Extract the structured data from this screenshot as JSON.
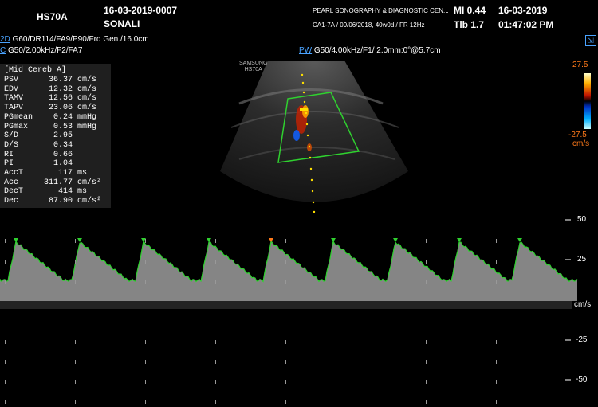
{
  "header": {
    "model": "HS70A",
    "patient_id": "16-03-2019-0007",
    "patient_name": "SONALI",
    "hospital": "PEARL SONOGRAPHY & DIAGNOSTIC CEN...",
    "exam_info": "CA1-7A / 09/06/2018, 40w0d / FR 12Hz",
    "mi": "MI  0.44",
    "tib": "Tlb 1.7",
    "date": "16-03-2019",
    "time": "01:47:02 PM"
  },
  "params": {
    "mode_2d_label": "2D",
    "mode_2d": "G60/DR114/FA9/P90/Frq Gen./16.0cm",
    "mode_c_label": "C",
    "mode_c": "G50/2.00kHz/F2/FA7",
    "mode_pw_label": "PW",
    "mode_pw": "G50/4.00kHz/F1/ 2.0mm:0°@5.7cm"
  },
  "logo": {
    "line1": "SAMSUNG",
    "line2": "HS70A"
  },
  "measurements": {
    "title": "[Mid Cereb A]",
    "rows": [
      {
        "label": "PSV",
        "value": "36.37",
        "unit": "cm/s"
      },
      {
        "label": "EDV",
        "value": "12.32",
        "unit": "cm/s"
      },
      {
        "label": "TAMV",
        "value": "12.56",
        "unit": "cm/s"
      },
      {
        "label": "TAPV",
        "value": "23.06",
        "unit": "cm/s"
      },
      {
        "label": "PGmean",
        "value": "0.24",
        "unit": "mmHg"
      },
      {
        "label": "PGmax",
        "value": "0.53",
        "unit": "mmHg"
      },
      {
        "label": "S/D",
        "value": "2.95",
        "unit": ""
      },
      {
        "label": "D/S",
        "value": "0.34",
        "unit": ""
      },
      {
        "label": "RI",
        "value": "0.66",
        "unit": ""
      },
      {
        "label": "PI",
        "value": "1.04",
        "unit": ""
      },
      {
        "label": "AccT",
        "value": "117",
        "unit": "ms"
      },
      {
        "label": "Acc",
        "value": "311.77",
        "unit": "cm/s²"
      },
      {
        "label": "DecT",
        "value": "414",
        "unit": "ms"
      },
      {
        "label": "Dec",
        "value": "87.90",
        "unit": "cm/s²"
      }
    ]
  },
  "color_scale": {
    "top": "27.5",
    "bottom": "-27.5",
    "unit": "cm/s"
  },
  "spectral_scale": {
    "ticks": [
      "50",
      "25",
      "cm/s",
      "-25",
      "-50"
    ],
    "unit": "cm/s"
  },
  "colors": {
    "accent": "#4aa3ff",
    "trace": "#2fd12f",
    "sector": "#2fd12f",
    "label_bar": "#ffd400"
  }
}
